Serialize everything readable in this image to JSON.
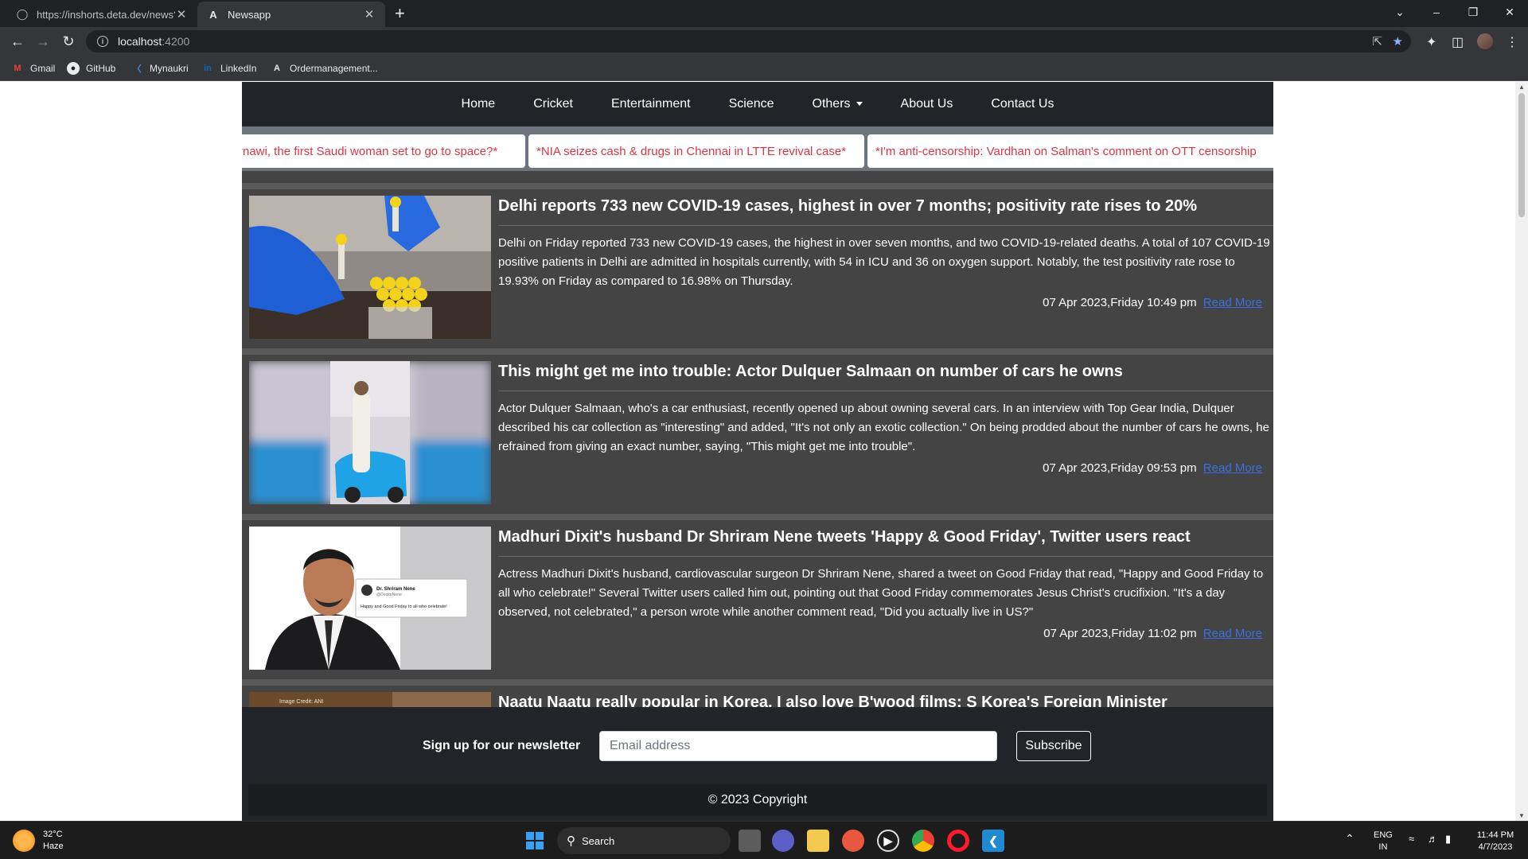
{
  "browser": {
    "tabs": [
      {
        "title": "https://inshorts.deta.dev/news?c",
        "favicon": "globe-icon"
      },
      {
        "title": "Newsapp",
        "favicon": "angular-icon"
      }
    ],
    "address": {
      "host": "localhost",
      "port": ":4200"
    },
    "bookmarks": [
      {
        "label": "Gmail",
        "icon": "gmail-icon"
      },
      {
        "label": "GitHub",
        "icon": "github-icon"
      },
      {
        "label": "Mynaukri",
        "icon": "naukri-icon"
      },
      {
        "label": "LinkedIn",
        "icon": "linkedin-icon"
      },
      {
        "label": "Ordermanagement...",
        "icon": "angular-icon"
      }
    ]
  },
  "nav": {
    "links": [
      "Home",
      "Cricket",
      "Entertainment",
      "Science",
      "Others",
      "About Us",
      "Contact Us"
    ]
  },
  "ticker": {
    "headlines": [
      "rnawi, the first Saudi woman set to go to space?*",
      "*NIA seizes cash & drugs in Chennai in LTTE revival case*",
      "*I'm anti-censorship: Vardhan on Salman's comment on OTT censorship"
    ]
  },
  "articles": [
    {
      "title": "Delhi reports 733 new COVID-19 cases, highest in over 7 months; positivity rate rises to 20%",
      "content": "Delhi on Friday reported 733 new COVID-19 cases, the highest in over seven months, and two COVID-19-related deaths. A total of 107 COVID-19 positive patients in Delhi are admitted in hospitals currently, with 54 in ICU and 36 on oxygen support. Notably, the test positivity rate rose to 19.93% on Friday as compared to 16.98% on Thursday.",
      "date": "07 Apr 2023,Friday 10:49 pm",
      "read_more": "Read More"
    },
    {
      "title": "This might get me into trouble: Actor Dulquer Salmaan on number of cars he owns",
      "content": "Actor Dulquer Salmaan, who's a car enthusiast, recently opened up about owning several cars. In an interview with Top Gear India, Dulquer described his car collection as \"interesting\" and added, \"It's not only an exotic collection.\" On being prodded about the number of cars he owns, he refrained from giving an exact number, saying, \"This might get me into trouble\".",
      "date": "07 Apr 2023,Friday 09:53 pm",
      "read_more": "Read More"
    },
    {
      "title": "Madhuri Dixit's husband Dr Shriram Nene tweets 'Happy & Good Friday', Twitter users react",
      "content": "Actress Madhuri Dixit's husband, cardiovascular surgeon Dr Shriram Nene, shared a tweet on Good Friday that read, \"Happy and Good Friday to all who celebrate!\" Several Twitter users called him out, pointing out that Good Friday commemorates Jesus Christ's crucifixion. \"It's a day observed, not celebrated,\" a person wrote while another comment read, \"Did you actually live in US?\"",
      "date": "07 Apr 2023,Friday 11:02 pm",
      "read_more": "Read More"
    },
    {
      "title": "Naatu Naatu really popular in Korea, I also love B'wood films: S Korea's Foreign Minister",
      "content": "",
      "date": "",
      "read_more": ""
    }
  ],
  "thumb_text": {
    "tweet_name": "Dr. Shriram Nene",
    "tweet_handle": "@DoctorNene",
    "tweet_body": "Happy and Good Friday to all who celebrate!",
    "credit": "Image Credit: ANI"
  },
  "newsletter": {
    "label": "Sign up for our newsletter",
    "placeholder": "Email address",
    "button": "Subscribe",
    "copyright": "© 2023 Copyright"
  },
  "taskbar": {
    "weather": {
      "temp": "32°C",
      "condition": "Haze"
    },
    "search": "Search",
    "lang": {
      "top": "ENG",
      "bottom": "IN"
    },
    "clock": {
      "time": "11:44 PM",
      "date": "4/7/2023"
    }
  },
  "colors": {
    "navbar": "#212529",
    "ticker_bg": "#6c757d",
    "ticker_text": "#dc3545",
    "card_bg": "#444444",
    "link": "#3b6fe0"
  }
}
